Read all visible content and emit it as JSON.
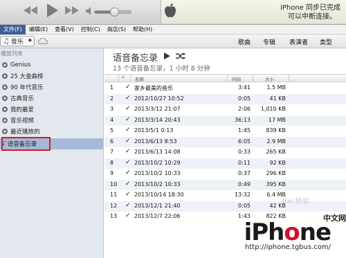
{
  "player": {
    "lcd_line1": "iPhone 同步已完成",
    "lcd_line2": "可以中断连接。"
  },
  "menu": [
    "文件(F)",
    "编辑(E)",
    "查看(V)",
    "控制(C)",
    "商店(S)",
    "帮助(H)"
  ],
  "toolbar": {
    "source_label": "音乐",
    "tabs": [
      "歌曲",
      "专辑",
      "表演者",
      "类型"
    ]
  },
  "sidebar": {
    "header": "播放列表",
    "items": [
      {
        "label": "Genius"
      },
      {
        "label": "25 大金曲榜"
      },
      {
        "label": "90 年代音乐"
      },
      {
        "label": "古典音乐"
      },
      {
        "label": "我的最爱"
      },
      {
        "label": "音乐视频"
      },
      {
        "label": "最近播放的"
      },
      {
        "label": "语音备忘录"
      }
    ]
  },
  "main": {
    "title": "语音备忘录",
    "subtitle": "13 个语音备忘录，1 小时 8 分钟",
    "columns": {
      "check": "✓",
      "name": "名称",
      "time": "时间",
      "size": "大小"
    },
    "rows": [
      {
        "num": "1",
        "check": "✓",
        "name": "家乡最美的音乐",
        "time": "3:41",
        "size": "1.5 MB"
      },
      {
        "num": "2",
        "check": "✓",
        "name": "2012/10/27 10:52",
        "time": "0:05",
        "size": "41 KB"
      },
      {
        "num": "3",
        "check": "✓",
        "name": "2013/3/12 21:07",
        "time": "2:06",
        "size": "1,010 KB"
      },
      {
        "num": "4",
        "check": "✓",
        "name": "2013/3/14 20:43",
        "time": "36:13",
        "size": "17 MB"
      },
      {
        "num": "5",
        "check": "✓",
        "name": "2013/5/1 0:13",
        "time": "1:45",
        "size": "839 KB"
      },
      {
        "num": "6",
        "check": "✓",
        "name": "2013/6/13 8:53",
        "time": "6:05",
        "size": "2.9 MB"
      },
      {
        "num": "7",
        "check": "✓",
        "name": "2013/6/13 14:08",
        "time": "0:33",
        "size": "265 KB"
      },
      {
        "num": "8",
        "check": "✓",
        "name": "2013/10/2 10:29",
        "time": "0:11",
        "size": "92 KB"
      },
      {
        "num": "9",
        "check": "✓",
        "name": "2013/10/2 10:33",
        "time": "0:37",
        "size": "296 KB"
      },
      {
        "num": "10",
        "check": "✓",
        "name": "2013/10/2 10:33",
        "time": "0:49",
        "size": "395 KB"
      },
      {
        "num": "11",
        "check": "✓",
        "name": "2013/10/14 18:30",
        "time": "13:32",
        "size": "6.4 MB"
      },
      {
        "num": "12",
        "check": "✓",
        "name": "2013/12/1 21:40",
        "time": "0:05",
        "size": "42 KB"
      },
      {
        "num": "13",
        "check": "✓",
        "name": "2013/12/7 22:06",
        "time": "1:43",
        "size": "822 KB"
      }
    ]
  },
  "watermark": {
    "logo_pre": "iPh",
    "logo_o": "o",
    "logo_post": "ne",
    "tag": "中文网",
    "url": "http://iphone.tgbus.com/",
    "baidu": "Bai 经验"
  },
  "colors": {
    "selection": "#a6b9d8",
    "highlight_box": "#d11b2a",
    "sidebar_bg": "#e3e7ee",
    "alt_row": "#eef2f8"
  }
}
